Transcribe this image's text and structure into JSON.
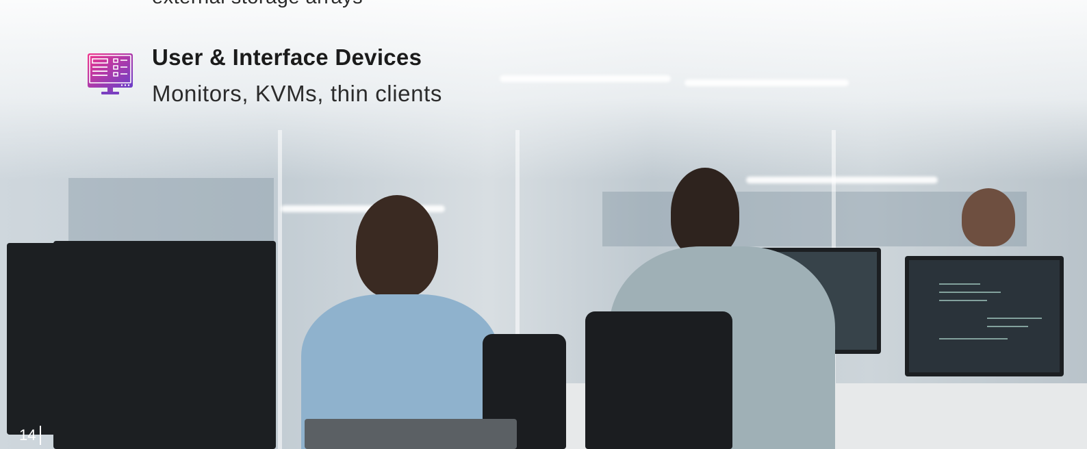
{
  "previous_item": {
    "description_fragment": "external storage arrays"
  },
  "item": {
    "icon": "monitor-dashboard-icon",
    "title": "User & Interface Devices",
    "description": "Monitors, KVMs, thin clients"
  },
  "footer": {
    "page_number": "14"
  },
  "colors": {
    "icon_gradient_start": "#e8338f",
    "icon_gradient_end": "#6a3fc8",
    "text": "#1b1b1b"
  }
}
